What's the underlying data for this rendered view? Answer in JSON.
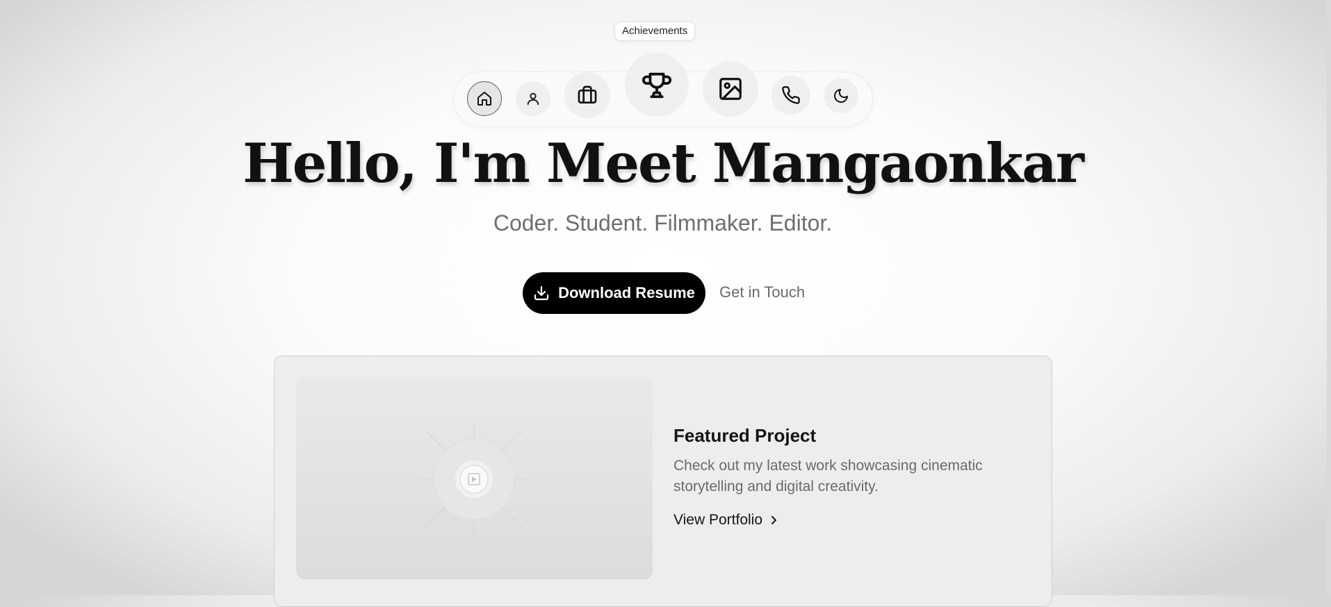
{
  "nav": {
    "tooltip": "Achievements",
    "items": [
      {
        "name": "Home",
        "icon": "home-icon"
      },
      {
        "name": "About",
        "icon": "user-icon"
      },
      {
        "name": "Experience",
        "icon": "briefcase-icon"
      },
      {
        "name": "Achievements",
        "icon": "trophy-icon"
      },
      {
        "name": "Gallery",
        "icon": "image-icon"
      },
      {
        "name": "Contact",
        "icon": "phone-icon"
      },
      {
        "name": "Theme",
        "icon": "moon-icon"
      }
    ]
  },
  "hero": {
    "title": "Hello, I'm Meet Mangaonkar",
    "subtitle": "Coder. Student. Filmmaker. Editor.",
    "primary_button": "Download Resume",
    "secondary_button": "Get in Touch"
  },
  "featured": {
    "title": "Featured Project",
    "description": "Check out my latest work showcasing cinematic storytelling and digital creativity.",
    "link": "View Portfolio"
  },
  "colors": {
    "primary": "#000000",
    "muted_text": "#6e6e6e"
  }
}
